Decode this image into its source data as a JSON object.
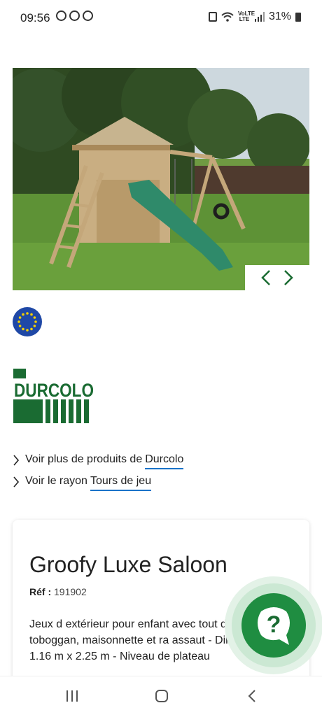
{
  "status_bar": {
    "time": "09:56",
    "battery": "31%",
    "network": "VoLTE LTE",
    "app_icons": [
      "whatsapp-icon",
      "record-icon",
      "messenger-icon"
    ]
  },
  "carousel": {
    "prev_icon": "chevron-left-icon",
    "next_icon": "chevron-right-icon"
  },
  "brand": {
    "logo_text": "DURCOLO"
  },
  "links": [
    {
      "prefix": "Voir plus de produits de",
      "link_text": "Durcolo"
    },
    {
      "prefix": "Voir le rayon",
      "link_text": "Tours de jeu"
    }
  ],
  "product": {
    "title": "Groofy Luxe Saloon",
    "ref_label": "Réf :",
    "ref_value": "191902",
    "description": "Jeux d extérieur pour enfant avec tout d balançoire, toboggan, maisonnette et ra assaut - Dimension: 1.16 m x 2.25 m - Niveau de plateau"
  },
  "help": {
    "icon": "question-chat-icon",
    "label": "?"
  },
  "colors": {
    "brand_green": "#1a6b32",
    "accent_green": "#2a9d4a",
    "link_blue": "#1a73c9",
    "eu_blue": "#1f48a6",
    "eu_star": "#f5d000"
  }
}
